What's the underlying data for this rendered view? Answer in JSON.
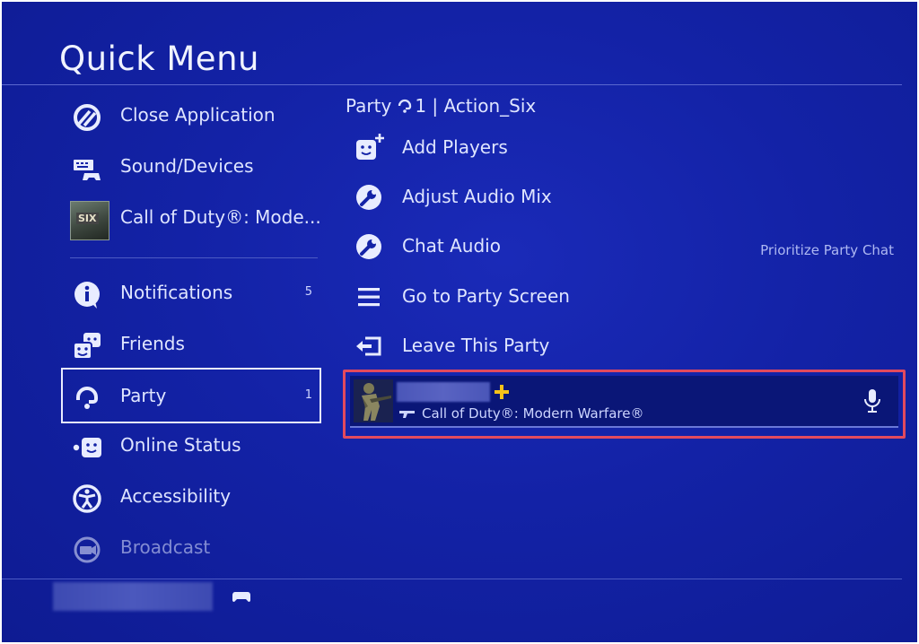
{
  "title": "Quick Menu",
  "left_menu": {
    "items": [
      {
        "label": "Close Application",
        "icon": "close-application-icon"
      },
      {
        "label": "Sound/Devices",
        "icon": "sound-devices-icon"
      },
      {
        "label": "Call of Duty®: Mode...",
        "icon": "game-thumbnail",
        "thumb_text": "SIX"
      },
      {
        "label": "Notifications",
        "icon": "notification-icon",
        "count": "5"
      },
      {
        "label": "Friends",
        "icon": "friends-icon"
      },
      {
        "label": "Party",
        "icon": "party-icon",
        "count": "1",
        "selected": true
      },
      {
        "label": "Online Status",
        "icon": "online-status-icon"
      },
      {
        "label": "Accessibility",
        "icon": "accessibility-icon"
      },
      {
        "label": "Broadcast",
        "icon": "broadcast-icon"
      }
    ]
  },
  "party": {
    "header_prefix": "Party",
    "member_count": "1",
    "separator": "|",
    "party_name": "Action_Six",
    "actions": [
      {
        "label": "Add Players",
        "icon": "add-players-icon"
      },
      {
        "label": "Adjust Audio Mix",
        "icon": "wrench-icon"
      },
      {
        "label": "Chat Audio",
        "icon": "wrench-icon",
        "value": "Prioritize Party Chat"
      },
      {
        "label": "Go to Party Screen",
        "icon": "menu-icon"
      },
      {
        "label": "Leave This Party",
        "icon": "leave-icon"
      }
    ],
    "member": {
      "game": "Call of Duty®: Modern Warfare®",
      "avatar": "soldier-avatar",
      "badge": "ps-plus-icon",
      "mic": "microphone-icon"
    }
  },
  "colors": {
    "background": "#1322a6",
    "highlight_border": "#e24a5e",
    "ps_plus": "#f6c21a"
  }
}
